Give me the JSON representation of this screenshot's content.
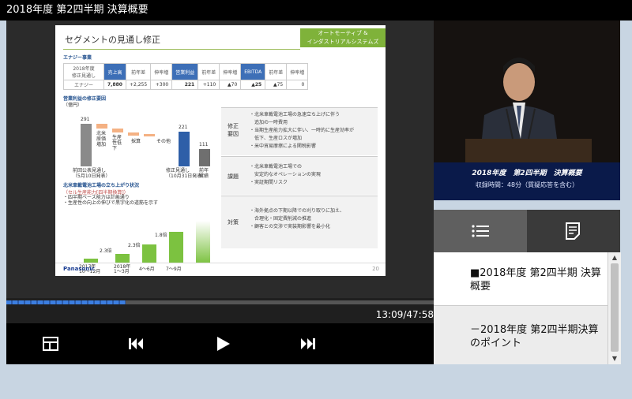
{
  "window": {
    "title": "2018年度 第2四半期 決算概要"
  },
  "slide": {
    "title": "セグメントの見通し修正",
    "badge_line1": "オートモーティブ &",
    "badge_line2": "インダストリアルシステムズ",
    "section_label": "エナジー事業",
    "table": {
      "headers": [
        "2018年度\n修正見通し",
        "売上高",
        "前年差",
        "伸率増",
        "営業利益",
        "前年差",
        "伸率増",
        "EBITDA",
        "前年差",
        "伸率増"
      ],
      "row_label": "エナジー",
      "values": [
        "7,880",
        "+2,255",
        "+300",
        "221",
        "+110",
        "▲70",
        "▲25",
        "▲75",
        "0"
      ]
    },
    "wf_label": "営業利益の修正要因",
    "wf_unit": "（億円）",
    "wf_items": [
      "291",
      "221",
      "111"
    ],
    "wf_captions": [
      "前回公表見通し\n（5月10日発表）",
      "修正見通し\n（10月31日発表）",
      "前年\n実績"
    ],
    "wf_steps": [
      "北米\n原価\n増加",
      "生産\n性低\n下",
      "採算",
      "その他"
    ],
    "right_rows": [
      {
        "label": "修正\n要因",
        "text": "・北米車載電池工場の急速立ち上げに伴う\n　追加の一時費用\n・当期生産能力拡大に伴い、一時的に生産効率が\n　低下、生産ロスが増加\n・米中貿易摩擦による関税影響"
      },
      {
        "label": "課題",
        "text": "・北米車載電池工場での\n　安定的なオペレーションの実現\n・実証期間リスク"
      },
      {
        "label": "対策",
        "text": "・海外拠点の下期以降での刈り取りに加え、\n　合理化・固定費削減の推進\n・顧客との交渉で実装期影響を最小化"
      }
    ],
    "growth_label": "北米車載電池工場の立ち上がり状況",
    "growth_sub": "（セル生産能力[四半期換算]）",
    "growth_note": "・四半期ベース能力は計画通り\n・生産性の向上の伸びで黒字化の道筋を示す",
    "growth_values": [
      "2.3倍",
      "2.3倍",
      "1.8倍"
    ],
    "growth_periods": [
      "2017年\n10〜12月",
      "2018年\n1〜3月",
      "4〜6月",
      "7〜9月"
    ],
    "footer_logo": "Panasonic",
    "page_number": "20"
  },
  "player": {
    "progress_fraction": 0.28,
    "time_display": "13:09/47:58"
  },
  "caption": {
    "line1": "2018年度　第2四半期　決算概要",
    "line2": "収録時間：48分（質疑応答を含む）"
  },
  "playlist": [
    {
      "label": "■2018年度 第2四半期 決算概要"
    },
    {
      "label": "－2018年度 第2四半期決算のポイント"
    }
  ],
  "icons": {
    "layout": "layout-icon",
    "prev": "skip-back-icon",
    "play": "play-icon",
    "next": "skip-forward-icon",
    "list": "list-icon",
    "notes": "notes-icon"
  },
  "colors": {
    "accent_blue": "#3d6fb7",
    "segment_green": "#7fb23a",
    "progress_blue": "#3c7ee0",
    "caption_bg": "#0a1a4a"
  }
}
